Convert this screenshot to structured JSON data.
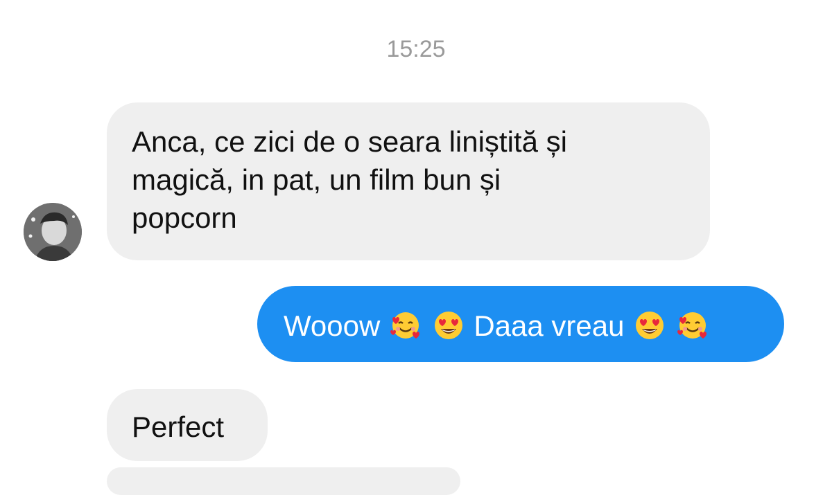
{
  "conversation": {
    "timestamp": "15:25",
    "messages": [
      {
        "from": "contact",
        "lines": [
          "Anca, ce zici de o seara liniștită și",
          "magică,  in pat, un film bun și",
          "popcorn"
        ]
      },
      {
        "from": "me",
        "parts": [
          "Wooow",
          "Daaa vreau"
        ],
        "emojis": [
          "smiling-face-with-hearts",
          "heart-eyes",
          "heart-eyes",
          "smiling-face-with-hearts"
        ]
      },
      {
        "from": "contact",
        "text": "Perfect"
      }
    ]
  },
  "colors": {
    "incoming_bubble": "#efefef",
    "outgoing_bubble": "#1d8ff2",
    "timestamp_text": "#9a9a9a"
  }
}
